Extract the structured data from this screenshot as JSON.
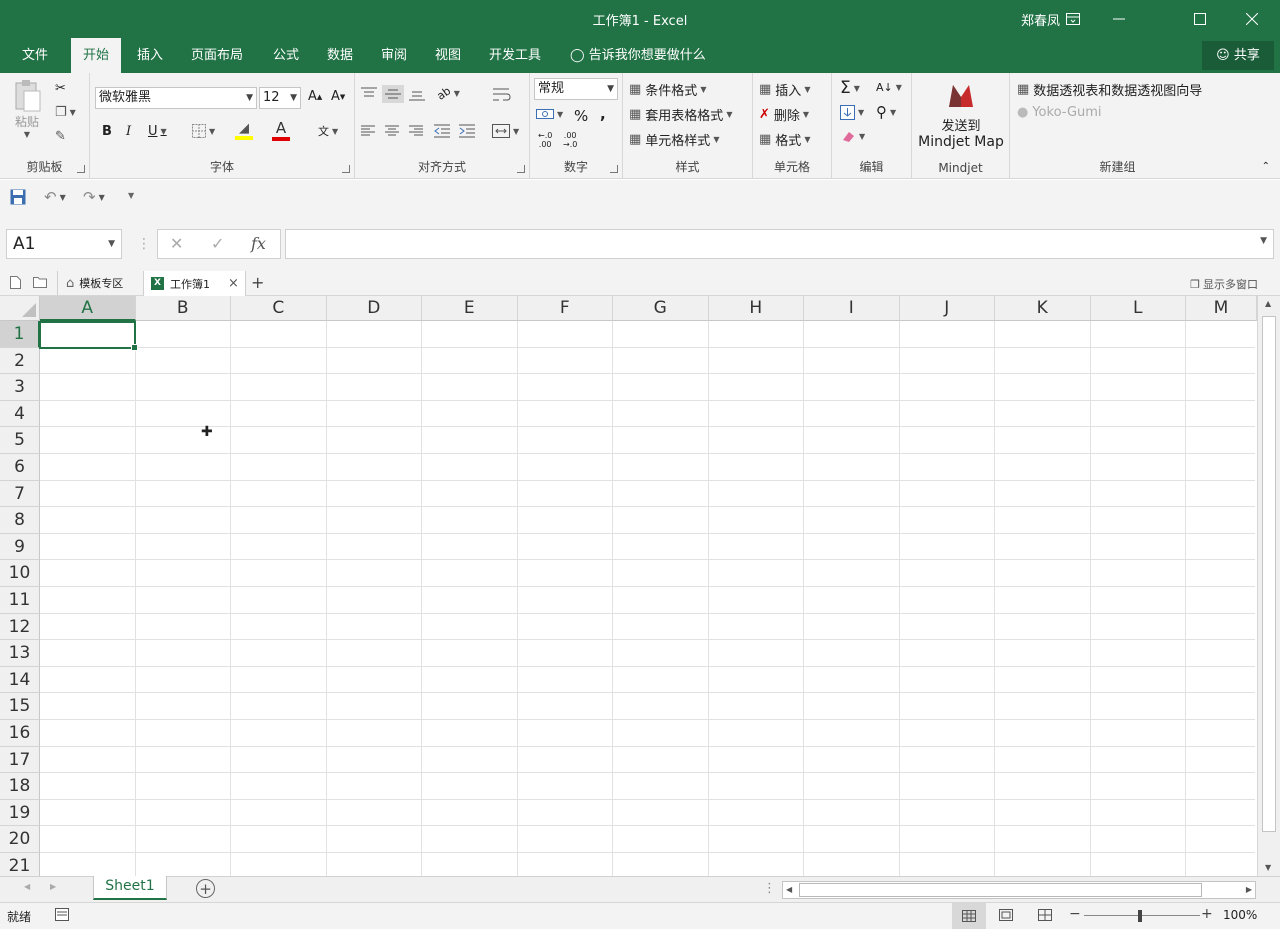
{
  "titlebar": {
    "title": "工作簿1  -  Excel",
    "user": "郑春凤",
    "bg_color": "#217346"
  },
  "menu": {
    "tabs": [
      "文件",
      "开始",
      "插入",
      "页面布局",
      "公式",
      "数据",
      "审阅",
      "视图",
      "开发工具"
    ],
    "active_tab": "开始",
    "tell_me": "告诉我你想要做什么",
    "share": "共享"
  },
  "ribbon": {
    "clipboard": {
      "label": "剪贴板",
      "paste": "粘贴"
    },
    "font": {
      "label": "字体",
      "font_name": "微软雅黑",
      "font_size": "12"
    },
    "alignment": {
      "label": "对齐方式"
    },
    "number": {
      "label": "数字",
      "format": "常规"
    },
    "styles": {
      "label": "样式",
      "conditional": "条件格式",
      "table": "套用表格格式",
      "cell_styles": "单元格样式"
    },
    "cells": {
      "label": "单元格",
      "insert": "插入",
      "delete": "删除",
      "format": "格式"
    },
    "editing": {
      "label": "编辑"
    },
    "mindjet": {
      "label": "Mindjet",
      "send_line1": "发送到",
      "send_line2": "Mindjet Map"
    },
    "newgroup": {
      "label": "新建组",
      "pivot": "数据透视表和数据透视图向导",
      "yoko": "Yoko-Gumi"
    }
  },
  "formula_bar": {
    "name_box": "A1",
    "fx": "fx",
    "value": ""
  },
  "doc_tabs": {
    "templates": "模板专区",
    "workbook": "工作簿1",
    "show_multi": "显示多窗口"
  },
  "sheet": {
    "columns": [
      "A",
      "B",
      "C",
      "D",
      "E",
      "F",
      "G",
      "H",
      "I",
      "J",
      "K",
      "L",
      "M"
    ],
    "rows": [
      "1",
      "2",
      "3",
      "4",
      "5",
      "6",
      "7",
      "8",
      "9",
      "10",
      "11",
      "12",
      "13",
      "14",
      "15",
      "16",
      "17",
      "18",
      "19",
      "20",
      "21"
    ],
    "active_cell": "A1"
  },
  "sheet_tabs": {
    "sheet1": "Sheet1"
  },
  "status": {
    "ready": "就绪",
    "zoom": "100%"
  }
}
